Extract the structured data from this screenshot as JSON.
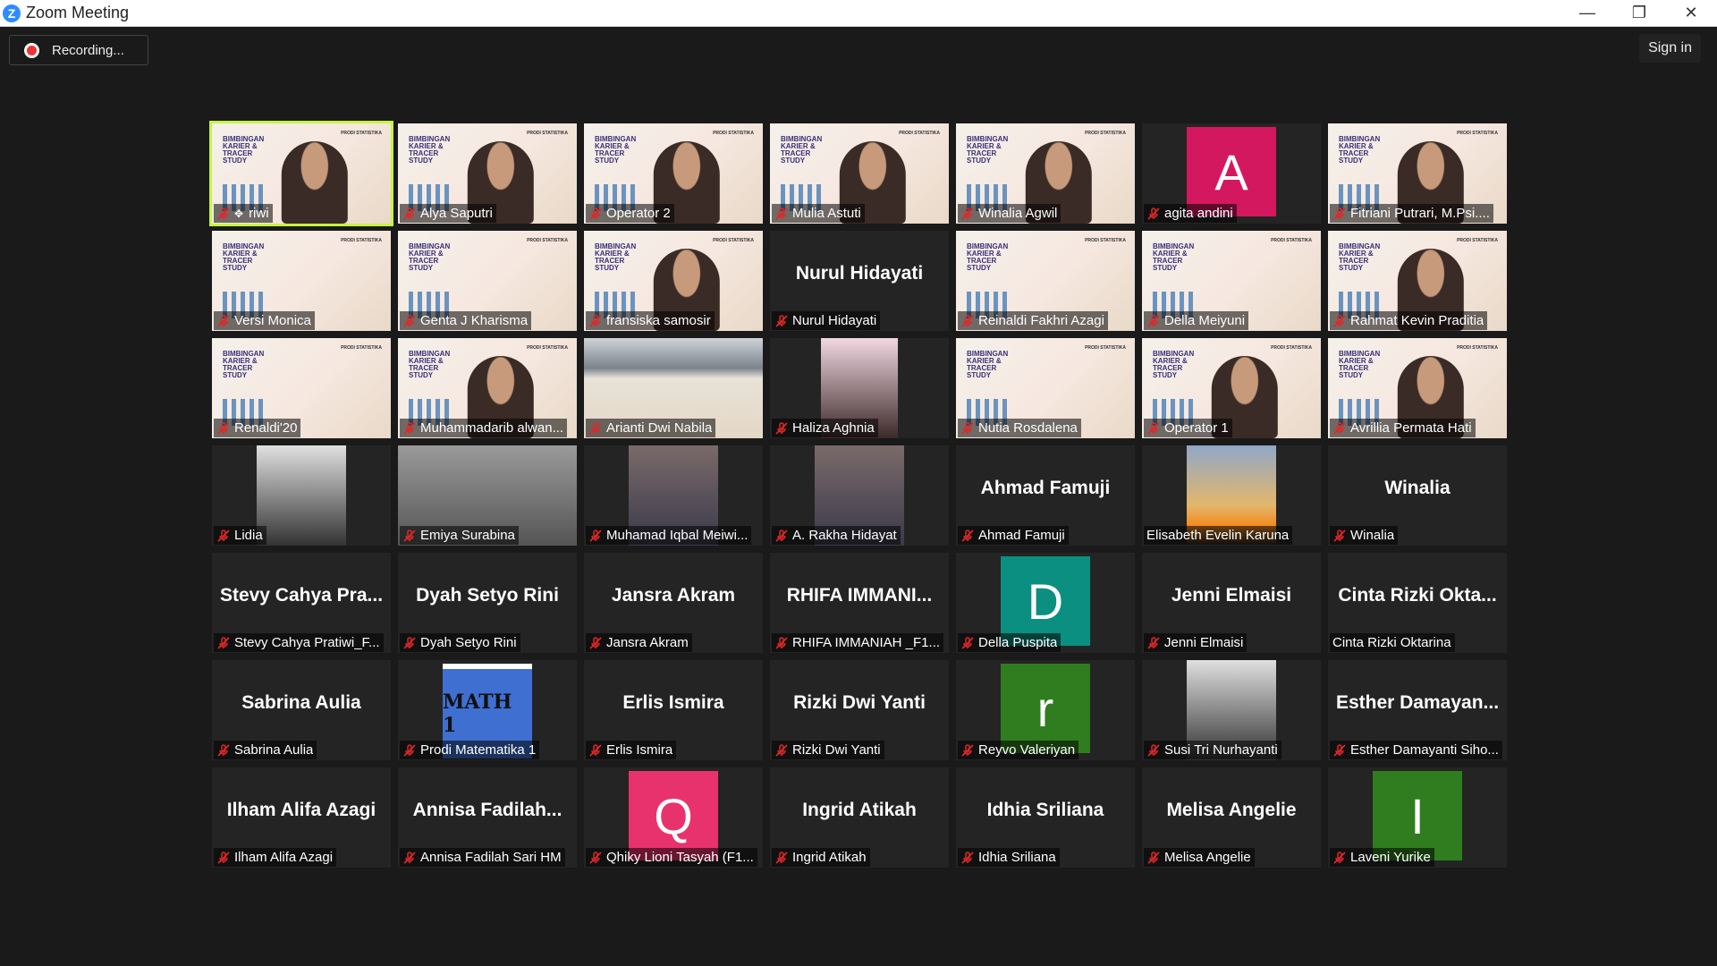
{
  "window": {
    "title": "Zoom Meeting",
    "logo_letter": "Z",
    "controls": {
      "minimize": "—",
      "restore": "❐",
      "close": "✕"
    }
  },
  "recording_label": "Recording...",
  "signin_label": "Sign in",
  "slide_text": {
    "title": "BIMBINGAN KARIER & TRACER STUDY",
    "brand": "PRODI STATISTIKA"
  },
  "avatar_colors": {
    "A": "#d4185f",
    "D": "#0a8f80",
    "r": "#2f7d1e",
    "Q": "#e8326e",
    "I": "#2f7d1e"
  },
  "tiles": [
    {
      "name": "riwi",
      "kind": "slide",
      "active": true,
      "pinned": true
    },
    {
      "name": "Alya Saputri",
      "kind": "slide"
    },
    {
      "name": "Operator 2",
      "kind": "slide"
    },
    {
      "name": "Mulia Astuti",
      "kind": "slide"
    },
    {
      "name": "Winalia Agwil",
      "kind": "slide"
    },
    {
      "name": "agita andini",
      "kind": "avatar",
      "letter": "A",
      "color": "#d4185f"
    },
    {
      "name": "Fitriani Putrari, M.Psi....",
      "kind": "slide"
    },
    {
      "name": "Versi Monica",
      "kind": "slide-empty"
    },
    {
      "name": "Genta J Kharisma",
      "kind": "slide-empty"
    },
    {
      "name": "fransiska samosir",
      "kind": "slide"
    },
    {
      "name": "Nurul Hidayati",
      "kind": "big",
      "big": "Nurul Hidayati"
    },
    {
      "name": "Reinaldi Fakhri Azagi",
      "kind": "slide-empty"
    },
    {
      "name": "Della Meiyuni",
      "kind": "slide-empty"
    },
    {
      "name": "Rahmat Kevin Praditia",
      "kind": "slide"
    },
    {
      "name": "Renaldi'20",
      "kind": "slide-empty"
    },
    {
      "name": "Muhammadarib alwan...",
      "kind": "slide"
    },
    {
      "name": "Arianti Dwi Nabila",
      "kind": "road"
    },
    {
      "name": "Haliza Aghnia",
      "kind": "photo",
      "photo": "pink"
    },
    {
      "name": "Nutia Rosdalena",
      "kind": "slide-empty"
    },
    {
      "name": "Operator 1",
      "kind": "slide"
    },
    {
      "name": "Avrillia Permata Hati",
      "kind": "slide"
    },
    {
      "name": "Lidia",
      "kind": "photo",
      "photo": "bw"
    },
    {
      "name": "Emiya Surabina",
      "kind": "graycam"
    },
    {
      "name": "Muhamad Iqbal Meiwi...",
      "kind": "photo",
      "photo": "room"
    },
    {
      "name": "A. Rakha Hidayat",
      "kind": "photo",
      "photo": "room"
    },
    {
      "name": "Ahmad Famuji",
      "kind": "big",
      "big": "Ahmad Famuji"
    },
    {
      "name": "Elisabeth Evelin Karuna",
      "kind": "photo",
      "photo": "sunset",
      "nomic": true
    },
    {
      "name": "Winalia",
      "kind": "big",
      "big": "Winalia"
    },
    {
      "name": "Stevy Cahya Pratiwi_F...",
      "kind": "big",
      "big": "Stevy Cahya Pra..."
    },
    {
      "name": "Dyah Setyo Rini",
      "kind": "big",
      "big": "Dyah Setyo Rini"
    },
    {
      "name": "Jansra Akram",
      "kind": "big",
      "big": "Jansra Akram"
    },
    {
      "name": "RHIFA IMMANIAH _F1...",
      "kind": "big",
      "big": "RHIFA IMMANI..."
    },
    {
      "name": "Della Puspita",
      "kind": "avatar",
      "letter": "D",
      "color": "#0a8f80"
    },
    {
      "name": "Jenni Elmaisi",
      "kind": "big",
      "big": "Jenni Elmaisi"
    },
    {
      "name": "Cinta Rizki Oktarina",
      "kind": "big",
      "big": "Cinta Rizki Okta...",
      "nomic": true
    },
    {
      "name": "Sabrina Aulia",
      "kind": "big",
      "big": "Sabrina Aulia"
    },
    {
      "name": "Prodi Matematika 1",
      "kind": "math",
      "big": "MATH 1"
    },
    {
      "name": "Erlis Ismira",
      "kind": "big",
      "big": "Erlis Ismira"
    },
    {
      "name": "Rizki Dwi Yanti",
      "kind": "big",
      "big": "Rizki Dwi Yanti"
    },
    {
      "name": "Reyvo Valeriyan",
      "kind": "avatar",
      "letter": "r",
      "color": "#2f7d1e"
    },
    {
      "name": "Susi Tri Nurhayanti",
      "kind": "photo",
      "photo": "bw"
    },
    {
      "name": "Esther Damayanti Siho...",
      "kind": "big",
      "big": "Esther Damayan..."
    },
    {
      "name": "Ilham Alifa Azagi",
      "kind": "big",
      "big": "Ilham Alifa Azagi"
    },
    {
      "name": "Annisa Fadilah Sari HM",
      "kind": "big",
      "big": "Annisa Fadilah..."
    },
    {
      "name": "Qhiky Lioni Tasyah (F1...",
      "kind": "avatar",
      "letter": "Q",
      "color": "#e8326e"
    },
    {
      "name": "Ingrid Atikah",
      "kind": "big",
      "big": "Ingrid Atikah"
    },
    {
      "name": "Idhia Sriliana",
      "kind": "big",
      "big": "Idhia Sriliana"
    },
    {
      "name": "Melisa Angelie",
      "kind": "big",
      "big": "Melisa Angelie"
    },
    {
      "name": "Laveni Yurike",
      "kind": "avatar",
      "letter": "I",
      "color": "#2f7d1e"
    }
  ]
}
